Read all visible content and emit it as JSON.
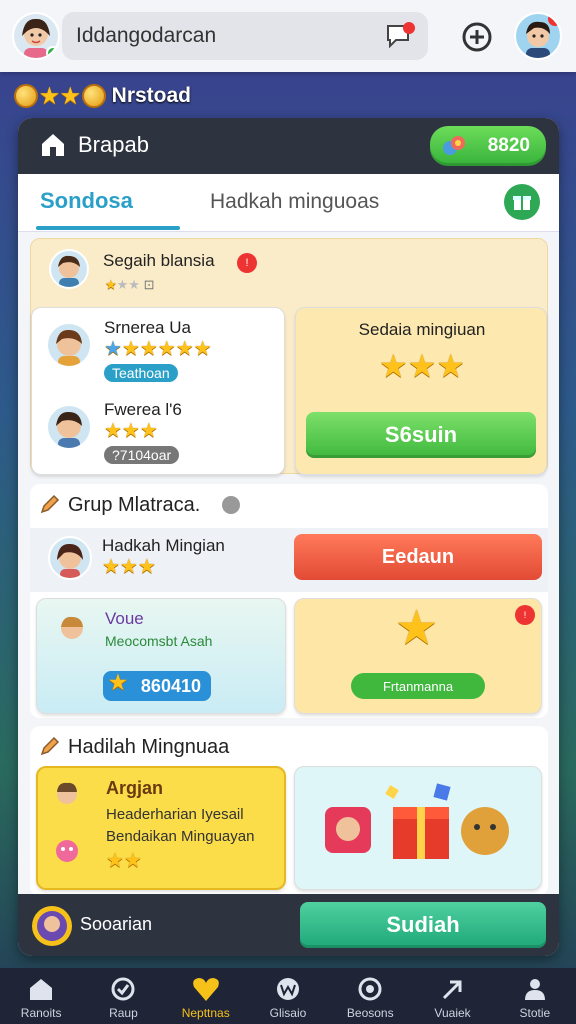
{
  "header": {
    "search_text": "Iddangodarcan",
    "profile_badge": "?"
  },
  "game_strip": {
    "title": "Nrstoad"
  },
  "panel": {
    "title": "Brapab",
    "currency": "8820",
    "tabs": [
      {
        "label": "Sondosa"
      },
      {
        "label": "Hadkah minguoas"
      }
    ]
  },
  "section1": {
    "header_name": "Segaih blansia",
    "players": [
      {
        "name": "Srnerea Ua",
        "stars": 6,
        "tag": "Teathoan"
      },
      {
        "name": "Fwerea l'6",
        "stars": 3,
        "tag": "?7104oar"
      }
    ],
    "reward_card": {
      "title": "Sedaia mingiuan",
      "stars": 3,
      "button": "S6suin"
    }
  },
  "section2": {
    "title": "Grup Mlatraca.",
    "row1": {
      "name": "Hadkah Mingian",
      "stars": 3,
      "button": "Eedaun"
    },
    "card_left": {
      "name": "Voue",
      "subtitle": "Meocomsbt Asah",
      "value": "860410"
    },
    "card_right": {
      "button": "Frtanmanna"
    }
  },
  "section3": {
    "title": "Hadilah Mingnuaa",
    "card": {
      "name": "Argjan",
      "line1": "Headerharian Iyesail",
      "line2": "Bendaikan Minguayan",
      "stars": 2
    }
  },
  "footer": {
    "name": "Sooarian",
    "button": "Sudiah"
  },
  "nav": [
    {
      "label": "Ranoits",
      "icon": "home-icon"
    },
    {
      "label": "Raup",
      "icon": "refresh-icon"
    },
    {
      "label": "Nepttnas",
      "icon": "heart-icon"
    },
    {
      "label": "Glisaio",
      "icon": "w-icon"
    },
    {
      "label": "Beosons",
      "icon": "target-icon"
    },
    {
      "label": "Vuaiek",
      "icon": "arrow-icon"
    },
    {
      "label": "Stotie",
      "icon": "person-icon"
    }
  ],
  "colors": {
    "accent": "#2aa0c8",
    "green": "#3fb83d",
    "red": "#e24a35",
    "dark": "#2e3340"
  }
}
